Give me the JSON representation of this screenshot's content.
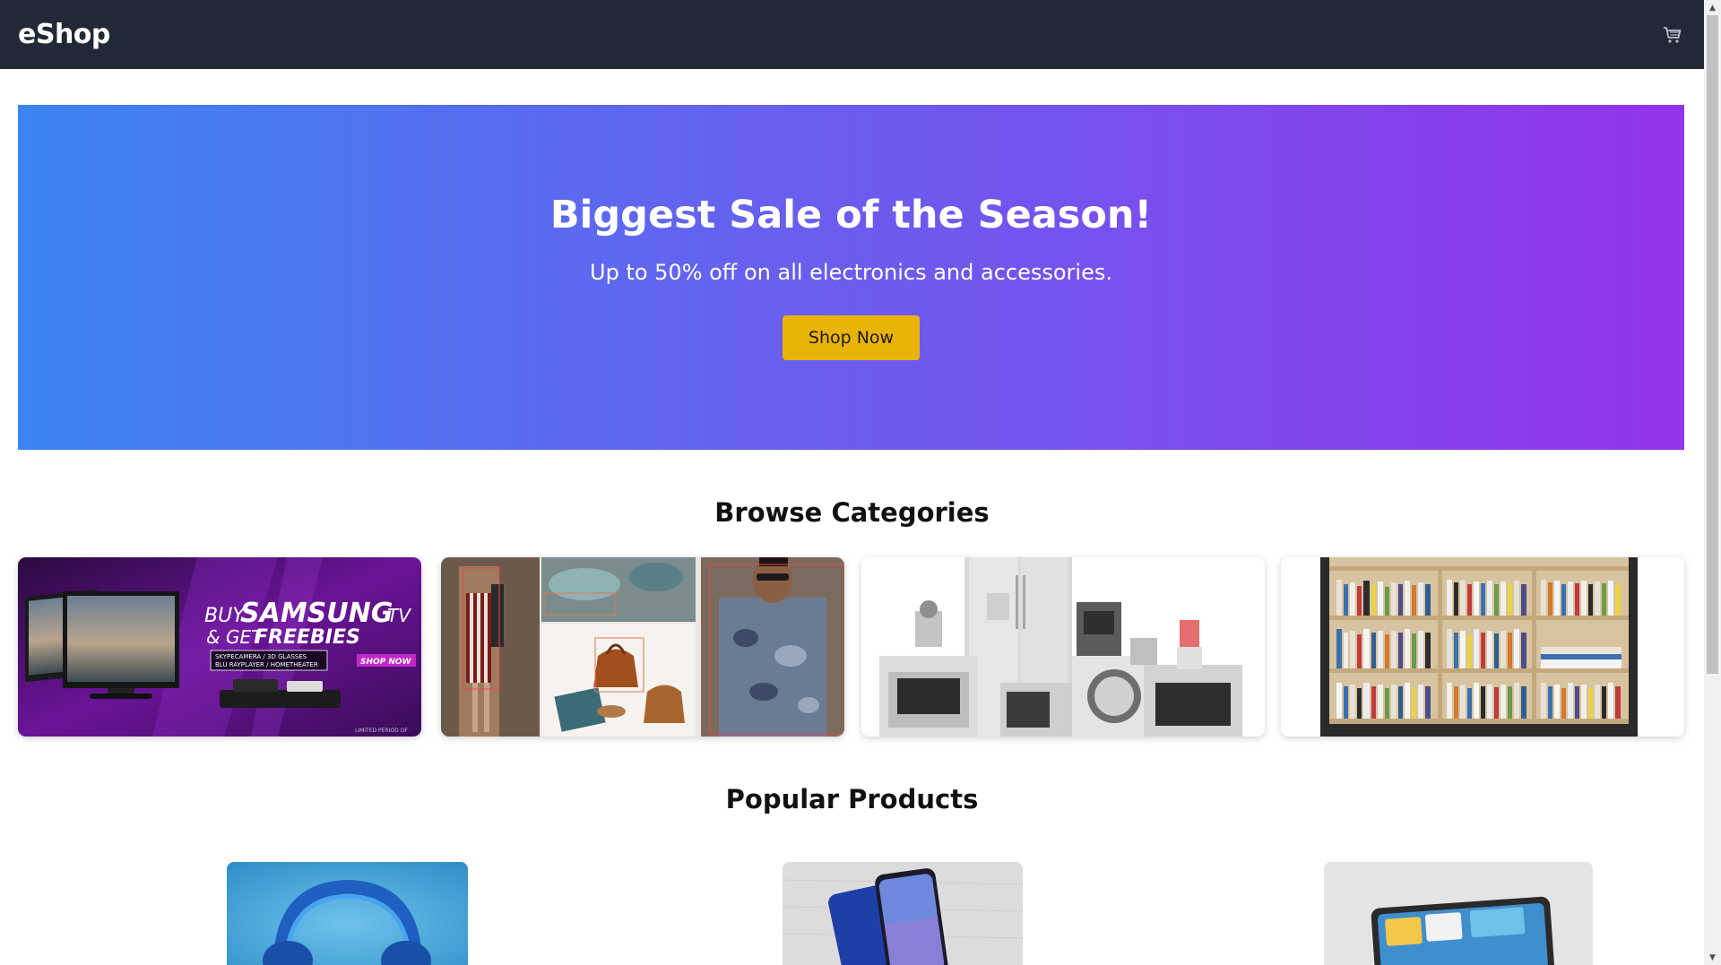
{
  "header": {
    "brand": "eShop",
    "cart_icon": "cart-icon"
  },
  "hero": {
    "title": "Biggest Sale of the Season!",
    "subtitle": "Up to 50% off on all electronics and accessories.",
    "cta_label": "Shop Now",
    "gradient_start": "#3c84f4",
    "gradient_end": "#9333ea",
    "cta_color": "#eab308"
  },
  "categories": {
    "title": "Browse Categories",
    "items": [
      {
        "image": "samsung-tv-promo-image",
        "banner_line1_a": "BUY",
        "banner_line1_b": "SAMSUNG",
        "banner_line1_c": "TV",
        "banner_line2_a": "& GET",
        "banner_line2_b": "FREEBIES",
        "banner_detail1": "SKYPECAMERA / 3D GLASSES",
        "banner_detail2": "BLU RAYPLAYER / HOMETHEATER",
        "banner_cta": "SHOP NOW",
        "banner_footnote": "LIMITED PERIOD OF"
      },
      {
        "image": "fashion-collage-image"
      },
      {
        "image": "home-appliances-image"
      },
      {
        "image": "bookshelf-image"
      }
    ]
  },
  "products": {
    "title": "Popular Products",
    "items": [
      {
        "image": "headphones-image"
      },
      {
        "image": "smartphone-image"
      },
      {
        "image": "tablet-image"
      }
    ]
  },
  "scrollbar": {
    "up_arrow": "▲",
    "down_arrow": "▼"
  }
}
